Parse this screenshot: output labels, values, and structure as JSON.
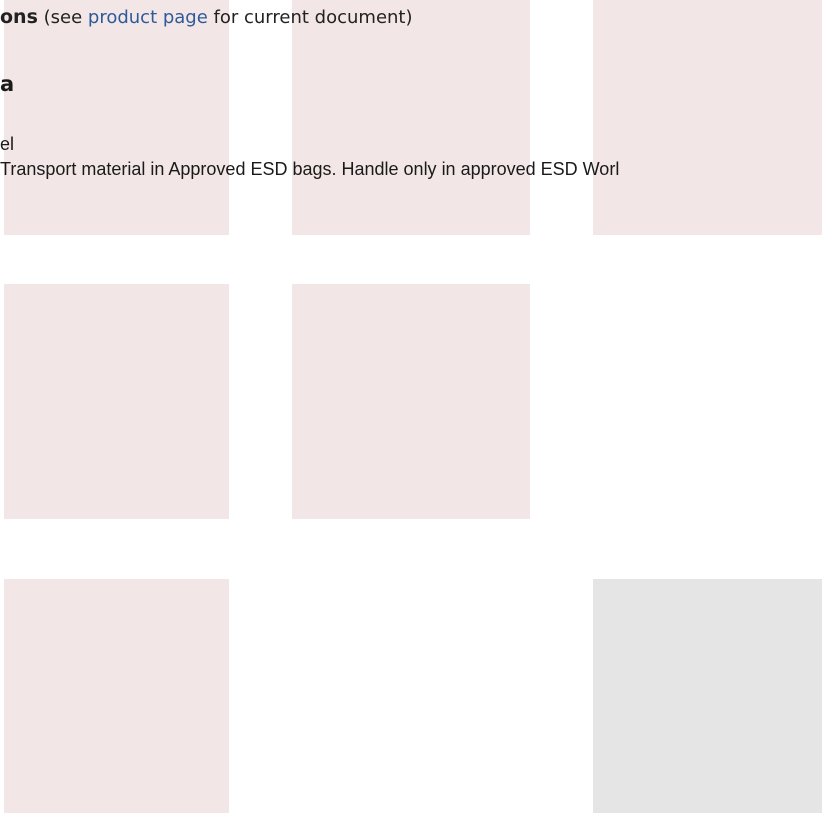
{
  "header": {
    "title_fragment": "ons",
    "prefix": " (see ",
    "link_label": "product page",
    "suffix": " for current document)"
  },
  "section": {
    "title_fragment": "a"
  },
  "esd": {
    "label_fragment": "el",
    "value_text": "Transport material in Approved ESD bags. Handle only in approved ESD Worl"
  },
  "colors": {
    "tile_pink": "#f3e6e6",
    "tile_grey": "#e5e5e5",
    "link": "#2d5a99"
  }
}
